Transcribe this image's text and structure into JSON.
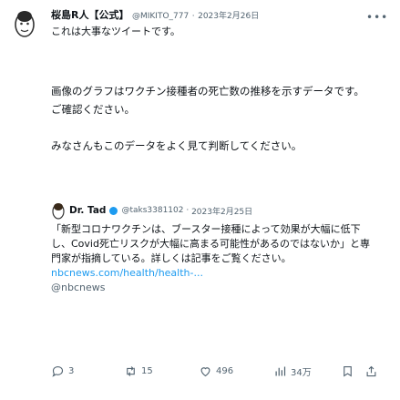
{
  "tweet": {
    "author_name": "桜島R人【公式】",
    "author_handle": "@MIKITO_777",
    "date": "2023年2月26日",
    "intro_line": "これは大事なツイートです。",
    "body_line1": "画像のグラフはワクチン接種者の死亡数の推移を示すデータです。",
    "body_line2": "ご確認ください。",
    "body_line3": "みなさんもこのデータをよく見て判断してください。"
  },
  "quote": {
    "author_name": "Dr. Tad",
    "author_handle": "@taks3381102",
    "date": "2023年2月25日",
    "text": "「新型コロナワクチンは、ブースター接種によって効果が大幅に低下し、Covid死亡リスクが大幅に高まる可能性があるのではないか」と専門家が指摘している。詳しくは記事をご覧ください。",
    "link": "nbcnews.com/health/health-...",
    "source": "@nbcnews"
  },
  "actions": {
    "replies": "3",
    "retweets": "15",
    "likes": "496",
    "views": "34万"
  },
  "colors": {
    "accent": "#1d9bf0",
    "text": "#0f1419",
    "muted": "#536471"
  }
}
